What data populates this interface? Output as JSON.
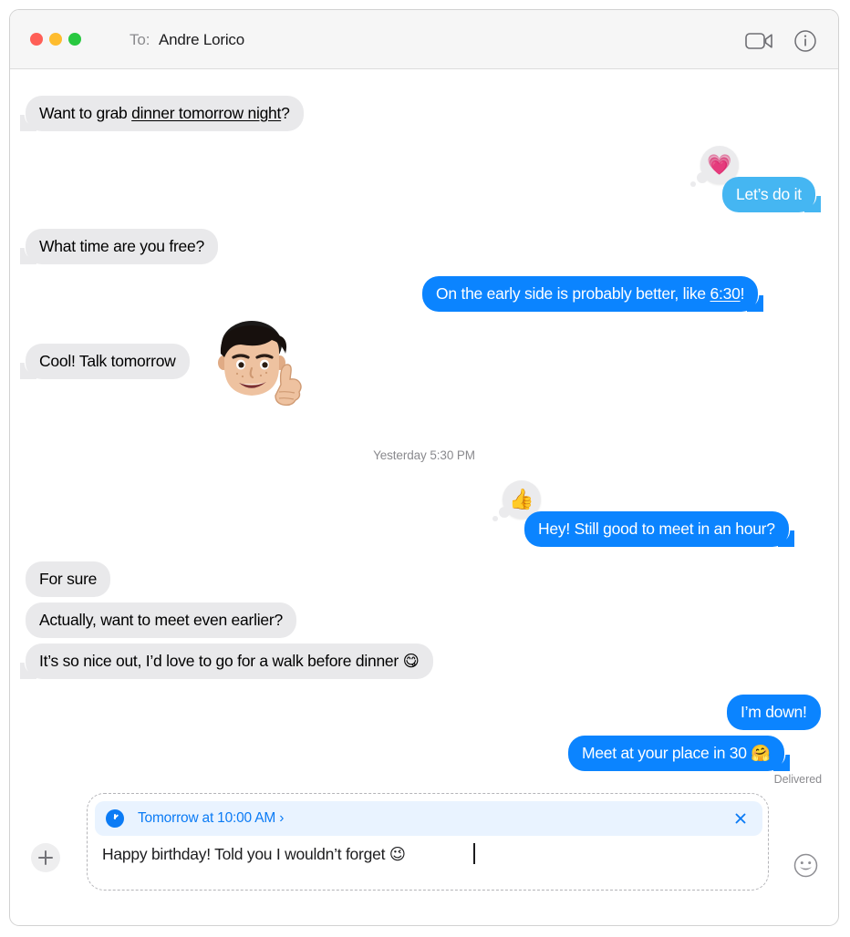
{
  "window": {
    "traffic_lights": {
      "close": "close-window",
      "minimize": "minimize-window",
      "maximize": "maximize-window"
    },
    "colors": {
      "incoming_bubble": "#e9e9eb",
      "outgoing_bubble": "#0b84ff",
      "outgoing_bubble_dimmed": "#45b6f2",
      "accent_blue": "#0b7bf5",
      "titlebar": "#f6f6f6",
      "secondary_text": "#8a8a8e",
      "schedule_pill_bg": "#e9f3ff"
    }
  },
  "header": {
    "to_label": "To:",
    "recipient": "Andre Lorico",
    "facetime_icon": "video-camera-icon",
    "info_icon": "info-circle-icon"
  },
  "conversation": {
    "messages": [
      {
        "id": "m1",
        "side": "incoming",
        "text_before_link": "Want to grab ",
        "link_text": "dinner tomorrow night",
        "text_after_link": "?",
        "full_text": "Want to grab dinner tomorrow night?",
        "has_tail": true
      },
      {
        "id": "m2",
        "side": "outgoing",
        "full_text": "Let’s do it",
        "has_tail": true,
        "dimmed": true,
        "tapback": "💗",
        "tapback_name": "heart-reaction"
      },
      {
        "id": "m3",
        "side": "incoming",
        "full_text": "What time are you free?",
        "has_tail": true
      },
      {
        "id": "m4",
        "side": "outgoing",
        "text_before_link": "On the early side is probably better, like ",
        "link_text": "6:30",
        "text_after_link": "!",
        "full_text": "On the early side is probably better, like 6:30!",
        "has_tail": true
      },
      {
        "id": "m5",
        "side": "incoming",
        "full_text": "Cool! Talk tomorrow",
        "has_tail": true,
        "sticker": "memoji-thumbs-up-sticker"
      }
    ],
    "daystamp": "Yesterday 5:30 PM",
    "messages2": [
      {
        "id": "m6",
        "side": "outgoing",
        "full_text": "Hey! Still good to meet in an hour?",
        "has_tail": true,
        "tapback": "👍",
        "tapback_name": "thumbs-up-reaction"
      },
      {
        "id": "m7",
        "side": "incoming",
        "full_text": "For sure",
        "has_tail": false
      },
      {
        "id": "m8",
        "side": "incoming",
        "full_text": "Actually, want to meet even earlier?",
        "has_tail": false
      },
      {
        "id": "m9",
        "side": "incoming",
        "full_text": "It’s so nice out, I’d love to go for a walk before dinner 😋",
        "has_tail": true
      },
      {
        "id": "m10",
        "side": "outgoing",
        "full_text": "I’m down!",
        "has_tail": false
      },
      {
        "id": "m11",
        "side": "outgoing",
        "full_text": "Meet at your place in 30 🤗",
        "has_tail": true
      }
    ],
    "delivery_status": "Delivered"
  },
  "composer": {
    "add_button_icon": "plus-icon",
    "schedule": {
      "clock_icon": "clock-icon",
      "label": "Tomorrow at 10:00 AM",
      "chevron": "›",
      "close_icon": "close-x-icon"
    },
    "message_value": "Happy birthday! Told you I wouldn’t forget 😉",
    "emoji_button_icon": "smiley-face-icon"
  }
}
